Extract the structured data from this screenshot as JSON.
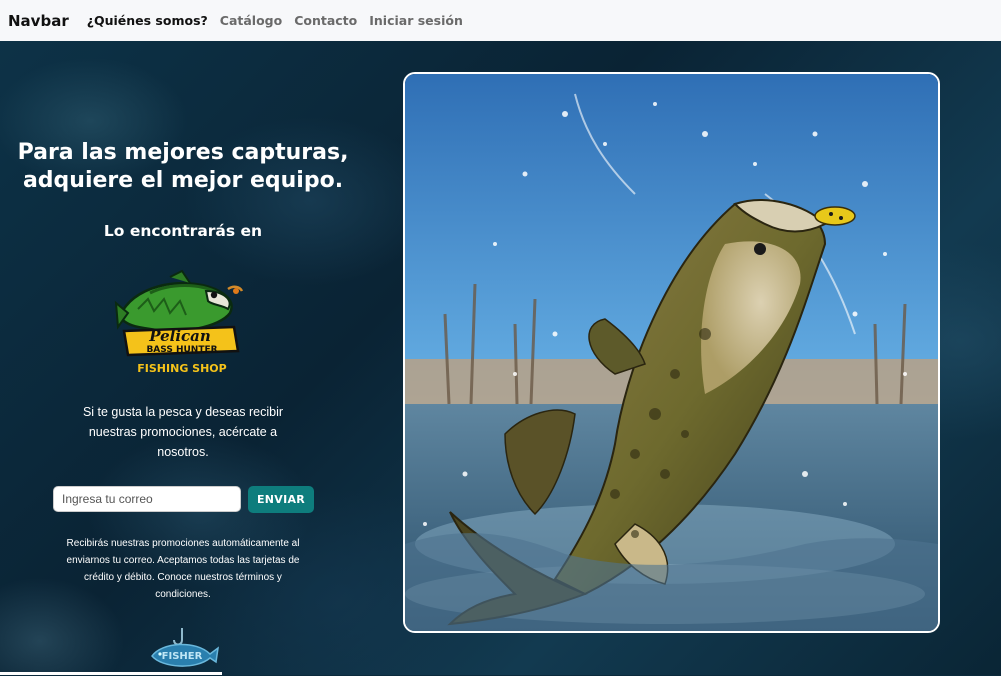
{
  "navbar": {
    "brand": "Navbar",
    "links": [
      {
        "label": "¿Quiénes somos?",
        "active": true
      },
      {
        "label": "Catálogo",
        "active": false
      },
      {
        "label": "Contacto",
        "active": false
      },
      {
        "label": "Iniciar sesión",
        "active": false
      }
    ]
  },
  "hero": {
    "headline_line1": "Para las mejores capturas,",
    "headline_line2": "adquiere el mejor equipo.",
    "subhead": "Lo encontrarás en",
    "logo": {
      "name_script": "Pelican",
      "name_banner": "BASS HUNTER",
      "tagline": "FISHING SHOP",
      "icon": "bass-fish-logo-icon"
    },
    "promo_text": "Si te gusta la pesca y deseas recibir nuestras promociones, acércate a nosotros.",
    "email": {
      "placeholder": "Ingresa tu correo",
      "value": ""
    },
    "send_label": "ENVIAR",
    "fine_print": "Recibirás nuestras promociones automáticamente al enviarnos tu correo. Aceptamos todas las tarjetas de crédito y débito. Conoce nuestros términos y condiciones.",
    "bottom_logo": {
      "text": "FISHER",
      "icon": "fish-hook-logo-icon"
    },
    "photo": {
      "subject": "largemouth bass jumping out of water",
      "icon": "bass-photo"
    }
  },
  "colors": {
    "navbar_bg": "#f7f8fa",
    "hero_bg": "#0b2a3c",
    "accent_button": "#0e7d7d",
    "logo_green": "#3a9a2e",
    "logo_yellow": "#f4c21a"
  }
}
